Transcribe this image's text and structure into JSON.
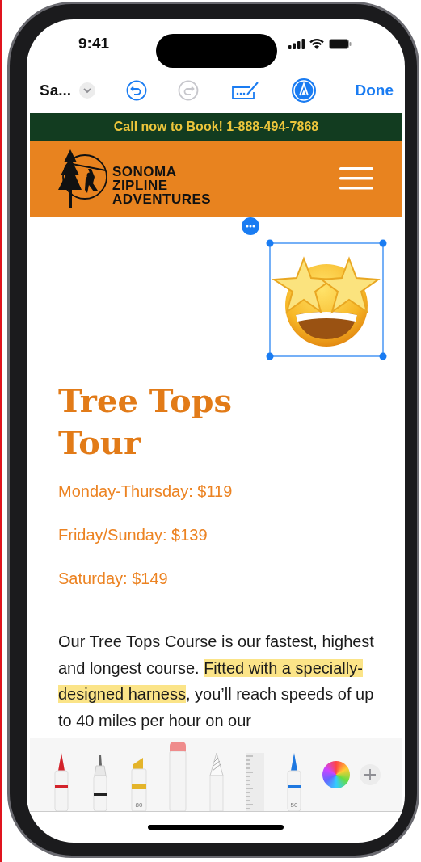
{
  "status_bar": {
    "time": "9:41"
  },
  "markup_toolbar": {
    "document_title": "Sa...",
    "undo_enabled": true,
    "redo_enabled": false,
    "done": "Done"
  },
  "web_page": {
    "banner": "Call now to Book! 1-888-494-7868",
    "logo_lines": [
      "SONOMA",
      "ZIPLINE",
      "ADVENTURES"
    ],
    "title_lines": [
      "Tree Tops",
      "Tour"
    ],
    "prices": [
      "Monday-Thursday: $119",
      "Friday/Sunday: $139",
      "Saturday: $149"
    ],
    "paragraph": [
      {
        "text": "Our Tree Tops Course is our fastest, highest and longest course. ",
        "highlighted": false
      },
      {
        "text": "Fitted with a specially-designed harness",
        "highlighted": true
      },
      {
        "text": ", you’ll reach speeds of up to 40 miles per hour on our",
        "highlighted": false
      }
    ]
  },
  "tools": [
    {
      "kind": "pen",
      "color": "#d3232b"
    },
    {
      "kind": "fineliner"
    },
    {
      "kind": "marker",
      "color": "#e4b42a",
      "label": "80"
    },
    {
      "kind": "eraser",
      "color": "#ef8c8c"
    },
    {
      "kind": "pencil"
    },
    {
      "kind": "ruler"
    },
    {
      "kind": "pen",
      "color": "#1f78e0",
      "label": "50"
    }
  ]
}
